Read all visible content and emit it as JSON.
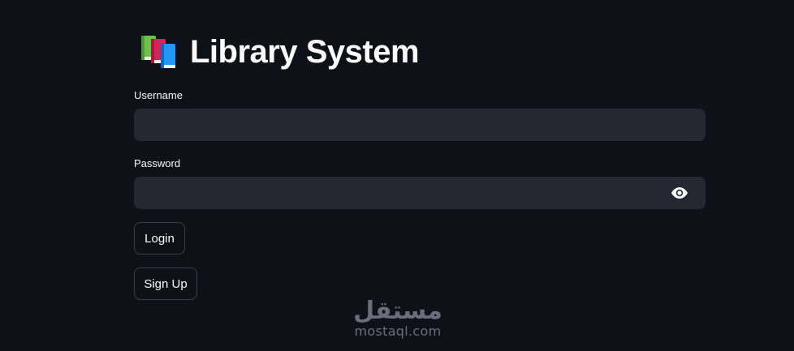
{
  "app": {
    "title": "Library System",
    "title_icon": "books-icon"
  },
  "form": {
    "username": {
      "label": "Username",
      "value": "",
      "placeholder": ""
    },
    "password": {
      "label": "Password",
      "value": "",
      "placeholder": "",
      "toggle_icon": "eye-icon"
    }
  },
  "buttons": {
    "login_label": "Login",
    "signup_label": "Sign Up"
  },
  "watermark": {
    "arabic": "مستقل",
    "latin": "mostaql.com"
  },
  "colors": {
    "background": "#0e1117",
    "input_background": "#262730",
    "text": "#fafafa",
    "button_border": "#3b3d47"
  }
}
